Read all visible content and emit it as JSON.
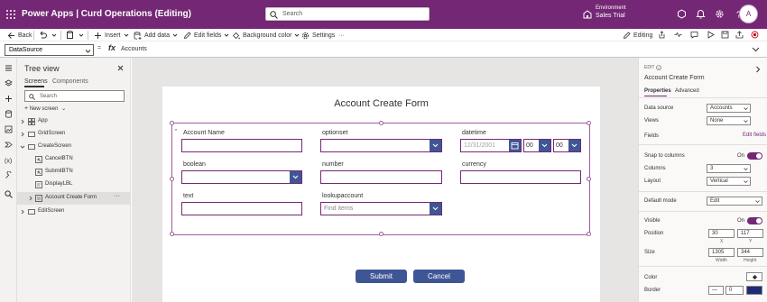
{
  "header": {
    "title": "Power Apps  |  Curd Operations (Editing)",
    "search_placeholder": "Search",
    "environment_label": "Environment",
    "environment_name": "Sales Trial",
    "avatar_initial": "A"
  },
  "commandbar": {
    "back": "Back",
    "insert": "Insert",
    "add_data": "Add data",
    "edit_fields": "Edit fields",
    "background_color": "Background color",
    "settings": "Settings",
    "more": "···",
    "editing": "Editing"
  },
  "formulabar": {
    "property": "DataSource",
    "fx": "fx",
    "eq": "=",
    "formula": "Accounts"
  },
  "treeview": {
    "title": "Tree view",
    "tabs": [
      "Screens",
      "Components"
    ],
    "search_placeholder": "Search",
    "new_screen": "New screen",
    "nodes": [
      {
        "label": "App"
      },
      {
        "label": "GridScreen"
      },
      {
        "label": "CreateScreen"
      },
      {
        "label": "CancelBTN"
      },
      {
        "label": "SubmitBTN"
      },
      {
        "label": "DisplayLBL"
      },
      {
        "label": "Account Create Form"
      },
      {
        "label": "EditScreen"
      }
    ],
    "more": "···"
  },
  "form": {
    "title": "Account Create Form",
    "fields": {
      "account_name": "Account Name",
      "optionset": "optionset",
      "datetime": "datetime",
      "boolean": "boolean",
      "number": "number",
      "currency": "currency",
      "text": "text",
      "lookupaccount": "lookupaccount"
    },
    "date_placeholder": "12/31/2001",
    "hour": "00",
    "minute": "00",
    "lookup_placeholder": "Find items",
    "submit": "Submit",
    "cancel": "Cancel"
  },
  "properties": {
    "edit_label": "EDIT",
    "control_name": "Account Create Form",
    "tabs": [
      "Properties",
      "Advanced"
    ],
    "data_source_label": "Data source",
    "data_source_value": "Accounts",
    "views_label": "Views",
    "views_value": "None",
    "fields_label": "Fields",
    "edit_fields_link": "Edit fields",
    "snap_label": "Snap to columns",
    "snap_value": "On",
    "columns_label": "Columns",
    "columns_value": "3",
    "layout_label": "Layout",
    "layout_value": "Vertical",
    "default_mode_label": "Default mode",
    "default_mode_value": "Edit",
    "visible_label": "Visible",
    "visible_value": "On",
    "position_label": "Position",
    "pos_x": "30",
    "pos_y": "117",
    "x_label": "X",
    "y_label": "Y",
    "size_label": "Size",
    "width": "1305",
    "height": "344",
    "width_label": "Width",
    "height_label": "Height",
    "color_label": "Color",
    "border_label": "Border",
    "border_width": "0"
  },
  "colors": {
    "brand": "#742774",
    "button": "#3f5696",
    "selection": "#9e5c9e"
  }
}
